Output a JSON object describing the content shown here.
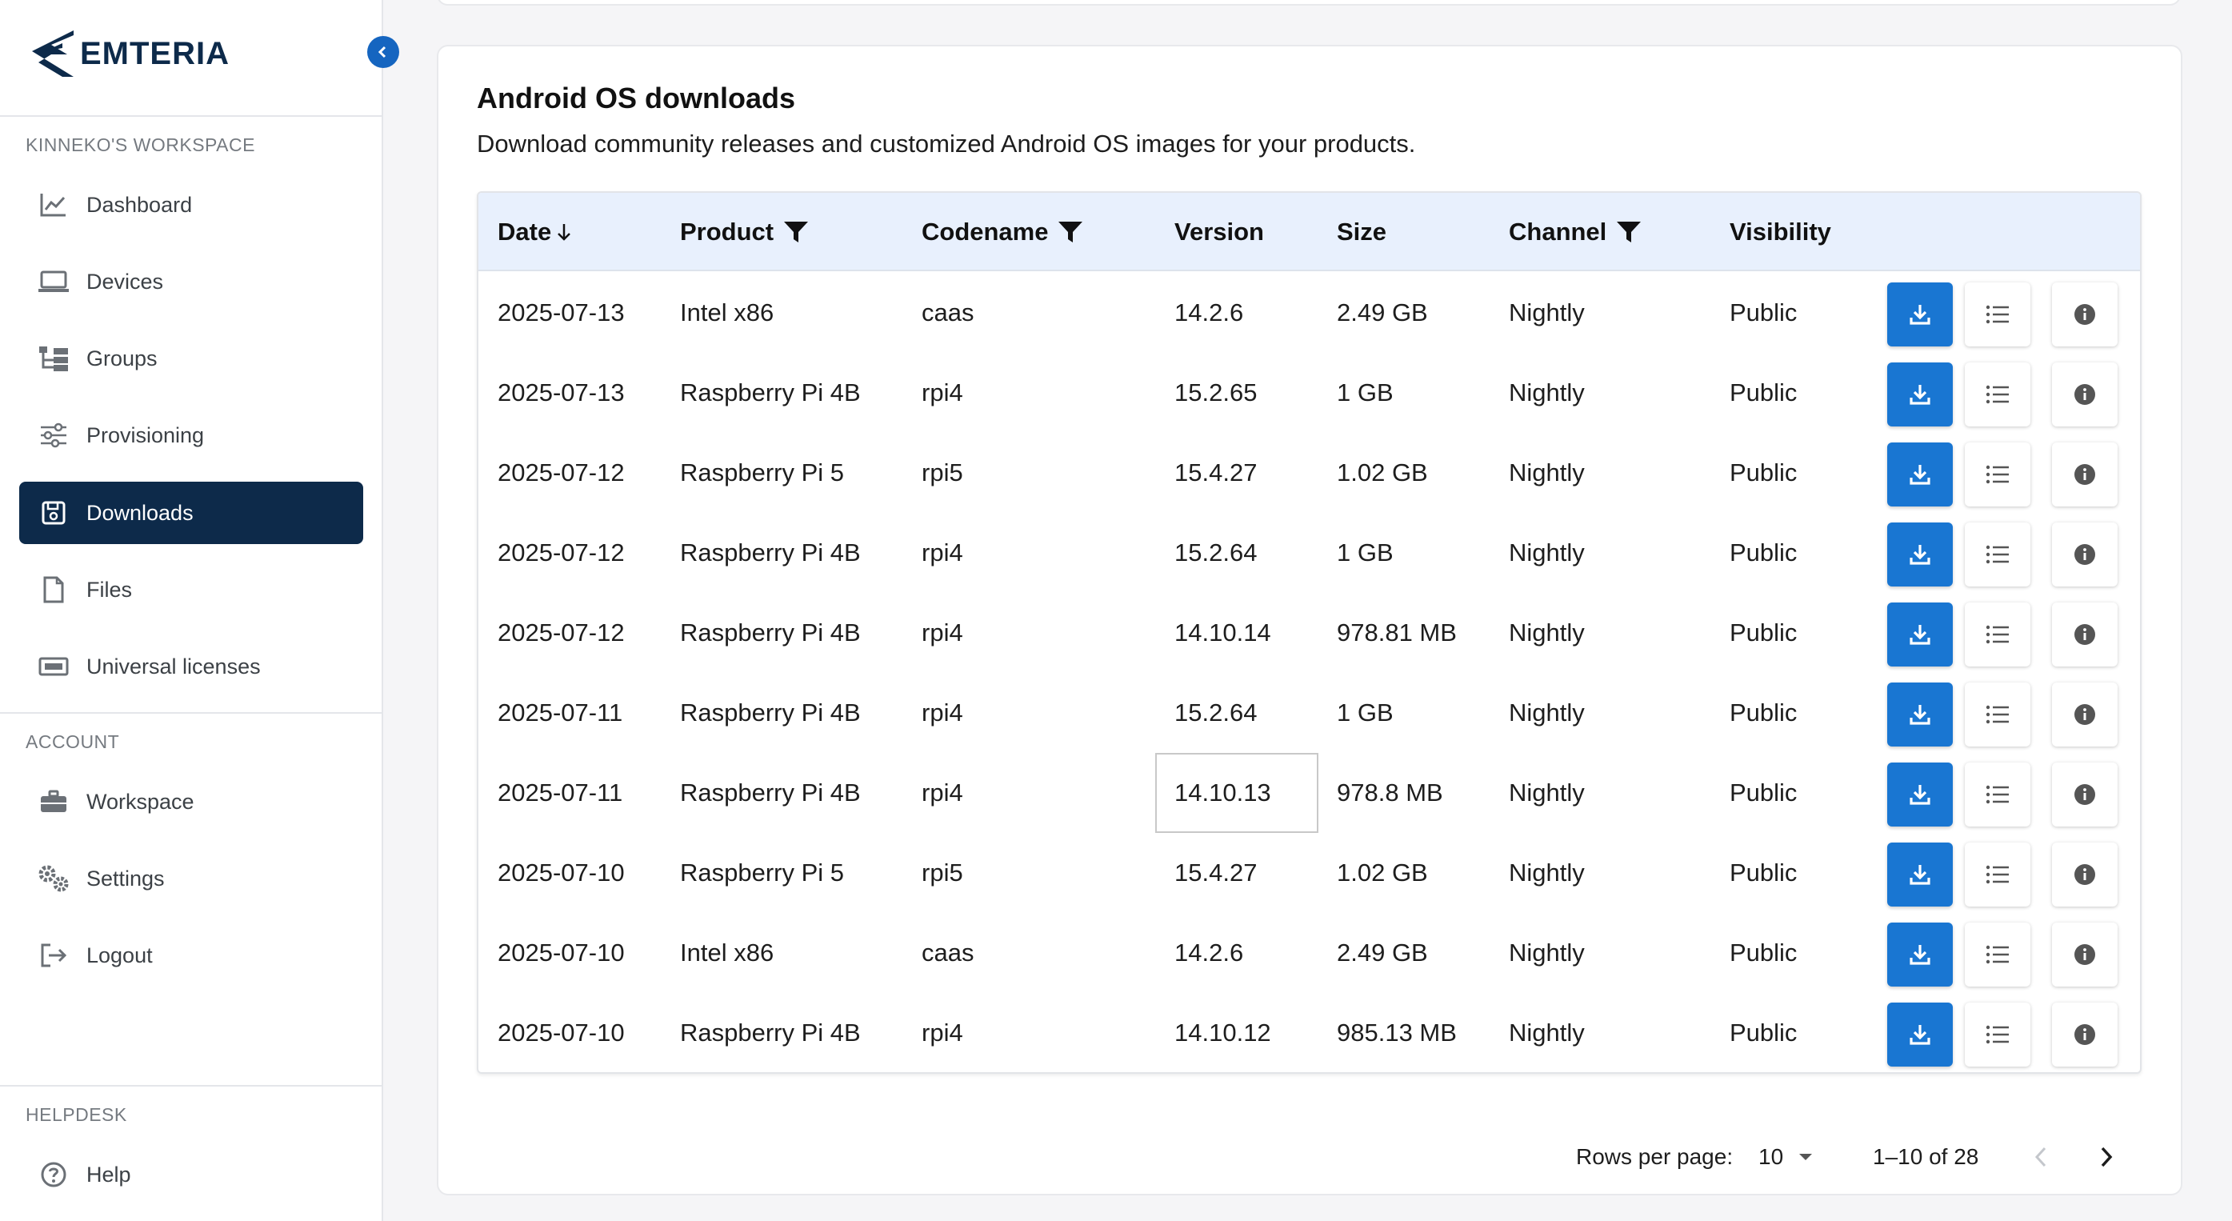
{
  "brand": {
    "name": "EMTERIA",
    "color": "#0d2a4a",
    "accent": "#1976d2"
  },
  "sidebar": {
    "workspace_label": "KINNEKO'S WORKSPACE",
    "workspace_items": [
      {
        "label": "Dashboard",
        "icon": "chart-line-icon"
      },
      {
        "label": "Devices",
        "icon": "laptop-icon"
      },
      {
        "label": "Groups",
        "icon": "tree-structure-icon"
      },
      {
        "label": "Provisioning",
        "icon": "sliders-icon"
      },
      {
        "label": "Downloads",
        "icon": "floppy-disk-icon",
        "active": true
      },
      {
        "label": "Files",
        "icon": "file-icon"
      },
      {
        "label": "Universal licenses",
        "icon": "license-card-icon"
      }
    ],
    "account_label": "ACCOUNT",
    "account_items": [
      {
        "label": "Workspace",
        "icon": "briefcase-icon"
      },
      {
        "label": "Settings",
        "icon": "gears-icon"
      },
      {
        "label": "Logout",
        "icon": "logout-icon"
      }
    ],
    "helpdesk_label": "HELPDESK",
    "helpdesk_items": [
      {
        "label": "Help",
        "icon": "question-circle-icon"
      }
    ]
  },
  "main": {
    "title": "Android OS downloads",
    "subtitle": "Download community releases and customized Android OS images for your products.",
    "columns": {
      "date": "Date",
      "product": "Product",
      "codename": "Codename",
      "version": "Version",
      "size": "Size",
      "channel": "Channel",
      "visibility": "Visibility"
    },
    "rows": [
      {
        "date": "2025-07-13",
        "product": "Intel x86",
        "codename": "caas",
        "version": "14.2.6",
        "size": "2.49 GB",
        "channel": "Nightly",
        "visibility": "Public"
      },
      {
        "date": "2025-07-13",
        "product": "Raspberry Pi 4B",
        "codename": "rpi4",
        "version": "15.2.65",
        "size": "1 GB",
        "channel": "Nightly",
        "visibility": "Public"
      },
      {
        "date": "2025-07-12",
        "product": "Raspberry Pi 5",
        "codename": "rpi5",
        "version": "15.4.27",
        "size": "1.02 GB",
        "channel": "Nightly",
        "visibility": "Public"
      },
      {
        "date": "2025-07-12",
        "product": "Raspberry Pi 4B",
        "codename": "rpi4",
        "version": "15.2.64",
        "size": "1 GB",
        "channel": "Nightly",
        "visibility": "Public"
      },
      {
        "date": "2025-07-12",
        "product": "Raspberry Pi 4B",
        "codename": "rpi4",
        "version": "14.10.14",
        "size": "978.81 MB",
        "channel": "Nightly",
        "visibility": "Public"
      },
      {
        "date": "2025-07-11",
        "product": "Raspberry Pi 4B",
        "codename": "rpi4",
        "version": "15.2.64",
        "size": "1 GB",
        "channel": "Nightly",
        "visibility": "Public"
      },
      {
        "date": "2025-07-11",
        "product": "Raspberry Pi 4B",
        "codename": "rpi4",
        "version": "14.10.13",
        "size": "978.8 MB",
        "channel": "Nightly",
        "visibility": "Public",
        "focused_cell": "version"
      },
      {
        "date": "2025-07-10",
        "product": "Raspberry Pi 5",
        "codename": "rpi5",
        "version": "15.4.27",
        "size": "1.02 GB",
        "channel": "Nightly",
        "visibility": "Public"
      },
      {
        "date": "2025-07-10",
        "product": "Intel x86",
        "codename": "caas",
        "version": "14.2.6",
        "size": "2.49 GB",
        "channel": "Nightly",
        "visibility": "Public"
      },
      {
        "date": "2025-07-10",
        "product": "Raspberry Pi 4B",
        "codename": "rpi4",
        "version": "14.10.12",
        "size": "985.13 MB",
        "channel": "Nightly",
        "visibility": "Public"
      }
    ],
    "row_actions": [
      {
        "icon": "download-icon",
        "style": "primary"
      },
      {
        "icon": "list-icon",
        "style": "plain"
      },
      {
        "icon": "info-icon",
        "style": "plain"
      }
    ],
    "pagination": {
      "rows_per_page_label": "Rows per page:",
      "rows_per_page": "10",
      "range": "1–10 of 28"
    }
  }
}
